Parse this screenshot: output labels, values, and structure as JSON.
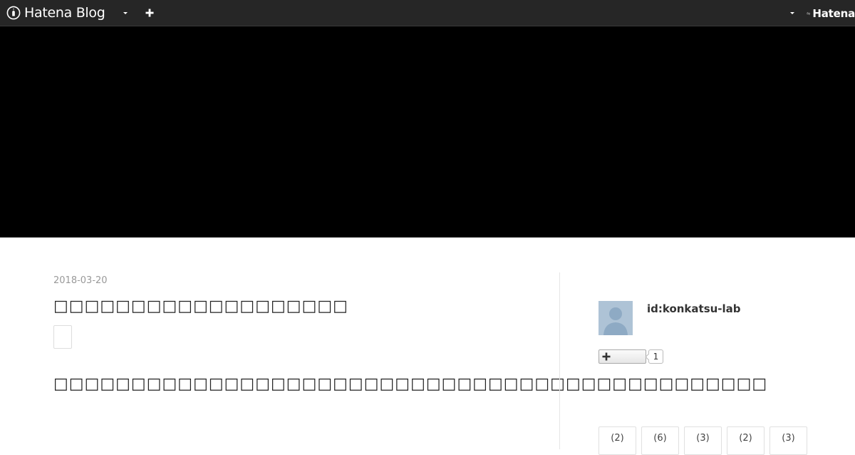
{
  "topbar": {
    "brand_text": "Hatena Blog",
    "right_brand_text": "Hatena",
    "icons": {
      "brand_logo": "hatena-blog-pen-icon",
      "dropdown": "caret-down-icon",
      "add": "plus-icon",
      "right_dropdown": "caret-down-icon",
      "right_logo": "hatena-wave-icon"
    }
  },
  "entry": {
    "date": "2018-03-20",
    "title": "□□□□□□□□□□□□□□□□□□□",
    "body": "□□□□□□□□□□□□□□□□□□□□□□□□□□□□□□□□□□□□□□□□□□□□□□"
  },
  "sidebar": {
    "profile_id": "id:konkatsu-lab",
    "follower_count": "1",
    "archive_counts": [
      "(2)",
      "(6)",
      "(3)",
      "(2)",
      "(3)"
    ]
  },
  "colors": {
    "topbar_bg": "#262626",
    "banner_bg": "#000000",
    "avatar_bg": "#aec3d6",
    "date_text": "#999999"
  }
}
